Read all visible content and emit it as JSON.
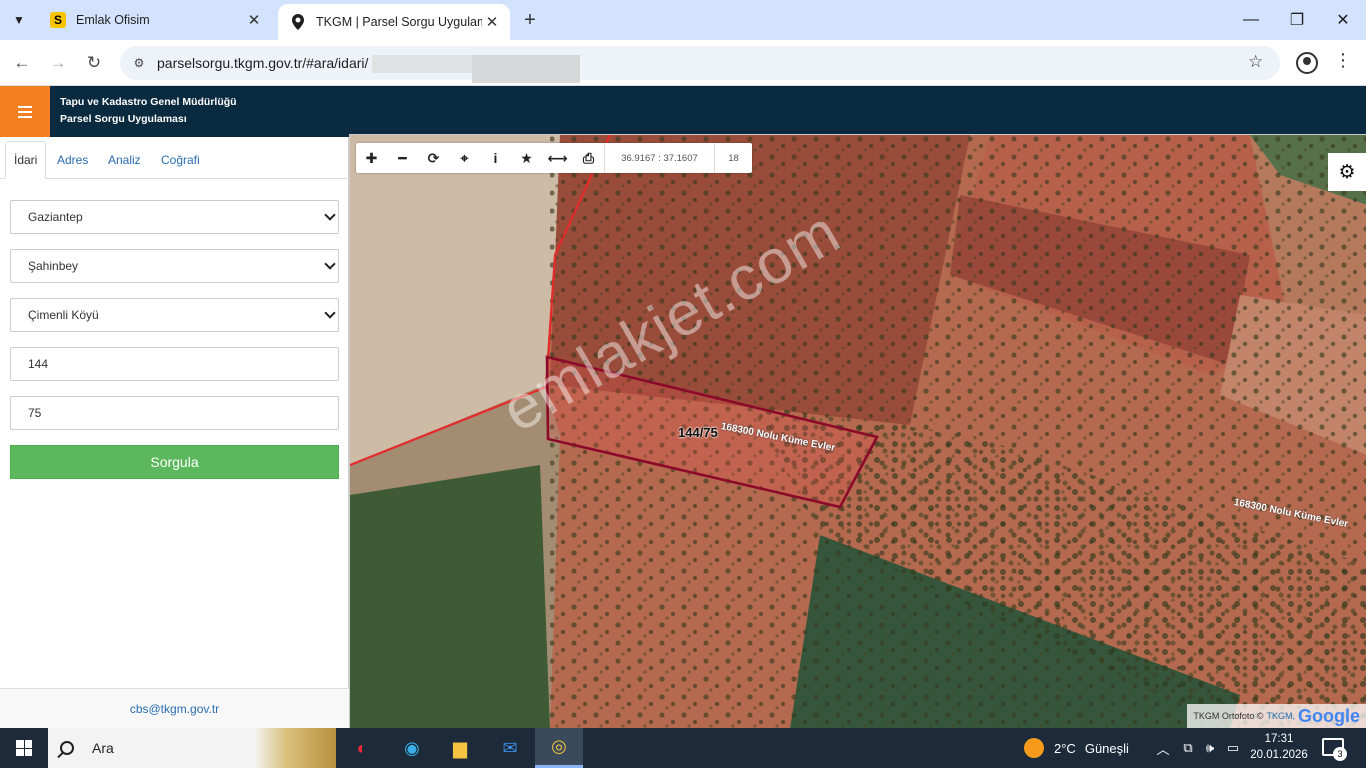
{
  "browser": {
    "tabs": [
      {
        "title": "Emlak Ofisim",
        "favicon": "S"
      },
      {
        "title": "TKGM | Parsel Sorgu Uygulaması",
        "active": true
      }
    ],
    "url": "parselsorgu.tkgm.gov.tr/#ara/idari/"
  },
  "app": {
    "title_line1": "Tapu ve Kadastro Genel Müdürlüğü",
    "title_line2": "Parsel Sorgu Uygulaması"
  },
  "panel": {
    "tabs": [
      "İdari",
      "Adres",
      "Analiz",
      "Coğrafi"
    ],
    "il": "Gaziantep",
    "ilce": "Şahinbey",
    "mahalle": "Çimenli Köyü",
    "ada": "144",
    "parsel": "75",
    "submit_label": "Sorgula",
    "email": "cbs@tkgm.gov.tr"
  },
  "map": {
    "coordinates": "36.9167 : 37.1607",
    "zoom": "18",
    "parcel_label": "144/75",
    "road_label_1": "168300 Nolu Küme Evler",
    "road_label_2": "168300 Nolu Küme Evler",
    "watermark": "emlakjet.com",
    "attribution_prefix": "TKGM Ortofoto ©",
    "attribution_link": "TKGM,",
    "attribution_brand": "Google",
    "colors": {
      "parcel_outline": "#8b0a2a",
      "boundary": "#e32b2b"
    }
  },
  "taskbar": {
    "search_label": "Ara",
    "weather_temp": "2°C",
    "weather_text": "Güneşli",
    "time": "17:31",
    "date": "20.01.2026",
    "notification_count": "3"
  }
}
